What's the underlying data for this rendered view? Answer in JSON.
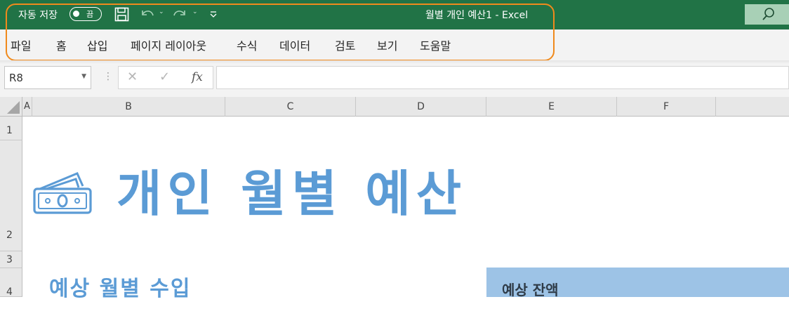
{
  "titlebar": {
    "autosave_label": "자동 저장",
    "autosave_state": "끔",
    "document_title": "월별 개인 예산1  -  Excel",
    "colors": {
      "background": "#217346",
      "search_box": "#a8d0b6"
    },
    "icons": [
      "save-icon",
      "undo-icon",
      "redo-icon",
      "customize-qat-icon",
      "search-icon"
    ]
  },
  "ribbon": {
    "tabs": [
      "파일",
      "홈",
      "삽입",
      "페이지 레이아웃",
      "수식",
      "데이터",
      "검토",
      "보기",
      "도움말"
    ]
  },
  "formula_bar": {
    "name_box": "R8",
    "cancel_symbol": "✕",
    "enter_symbol": "✓",
    "fx_label": "fx",
    "formula_value": ""
  },
  "grid": {
    "columns": [
      "A",
      "B",
      "C",
      "D",
      "E",
      "F"
    ],
    "rows": [
      "1",
      "2",
      "3",
      "4"
    ]
  },
  "sheet": {
    "title": "개인 월별 예산",
    "section_income": "예상 월별 수입",
    "balance_label": "예상 잔액",
    "colors": {
      "title": "#5b9bd5",
      "balance_fill": "#9dc3e6"
    }
  }
}
